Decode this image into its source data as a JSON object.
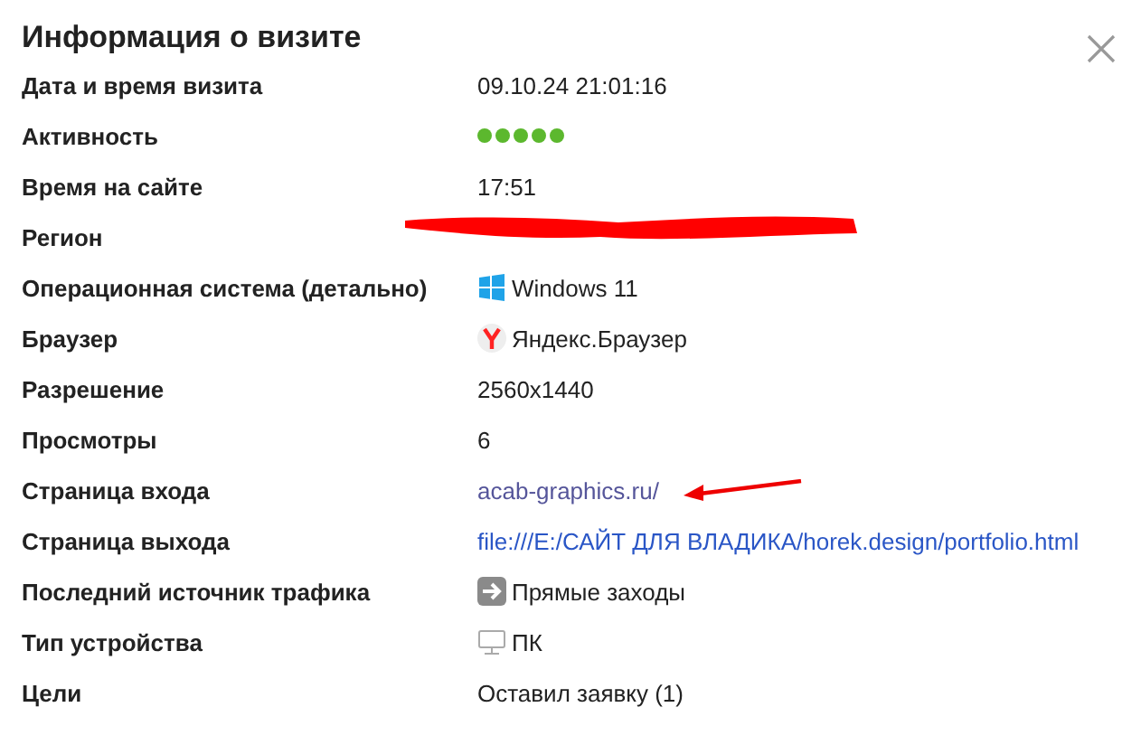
{
  "dialog": {
    "title": "Информация о визите"
  },
  "rows": [
    {
      "label": "Дата и время визита",
      "kind": "text",
      "value": "09.10.24 21:01:16"
    },
    {
      "label": "Активность",
      "kind": "dots",
      "stars": 5
    },
    {
      "label": "Время на сайте",
      "kind": "text",
      "value": "17:51"
    },
    {
      "label": "Регион",
      "kind": "redacted"
    },
    {
      "label": "Операционная система (детально)",
      "kind": "os",
      "value": "Windows 11"
    },
    {
      "label": "Браузер",
      "kind": "browser",
      "value": "Яндекс.Браузер"
    },
    {
      "label": "Разрешение",
      "kind": "text",
      "value": "2560x1440"
    },
    {
      "label": "Просмотры",
      "kind": "text",
      "value": "6"
    },
    {
      "label": "Страница входа",
      "kind": "link",
      "visited": true,
      "annotated": true,
      "value": "acab-graphics.ru/"
    },
    {
      "label": "Страница выхода",
      "kind": "link",
      "visited": false,
      "annotated": false,
      "value": "file:///E:/САЙТ ДЛЯ ВЛАДИКА/horek.design/portfolio.html"
    },
    {
      "label": "Последний источник трафика",
      "kind": "source",
      "value": "Прямые заходы"
    },
    {
      "label": "Тип устройства",
      "kind": "device",
      "value": "ПК"
    },
    {
      "label": "Цели",
      "kind": "text",
      "value": "Оставил заявку (1)"
    }
  ]
}
